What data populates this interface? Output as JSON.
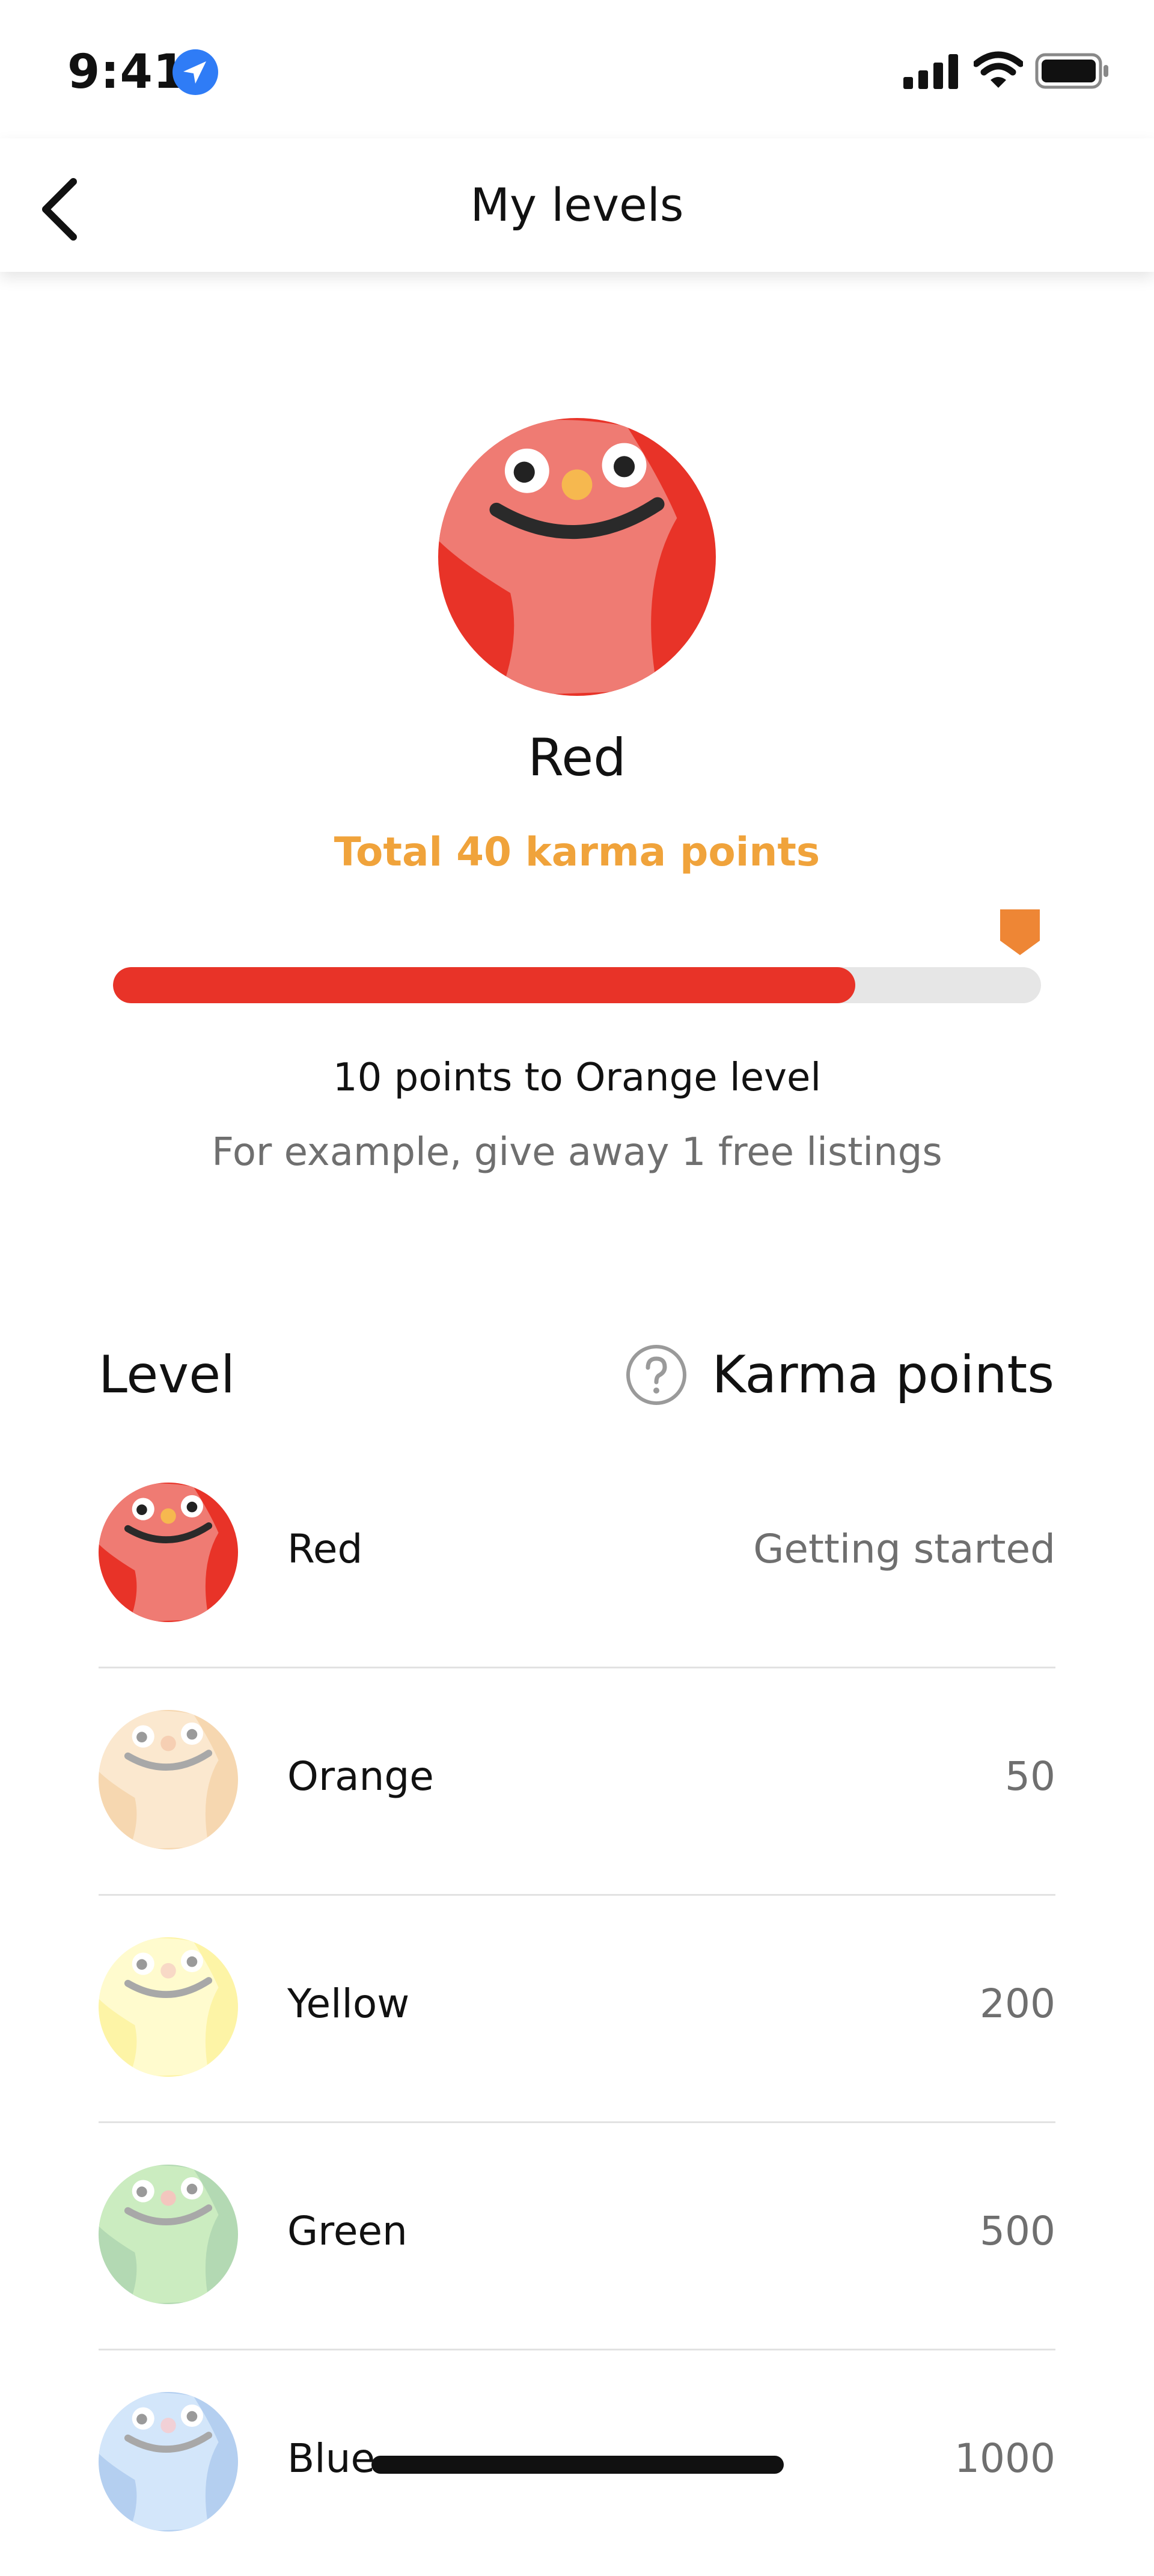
{
  "status_bar": {
    "time": "9:41",
    "icons": [
      "location-arrow-icon",
      "cellular-signal-icon",
      "wifi-icon",
      "battery-icon"
    ]
  },
  "nav": {
    "title": "My levels",
    "back_icon": "chevron-left-icon"
  },
  "current_level": {
    "name": "Red",
    "total_label": "Total 40 karma points",
    "progress_fraction": 0.8,
    "next_level_label": "10 points to Orange level",
    "hint": "For example, give away 1 free listings"
  },
  "table": {
    "level_header": "Level",
    "karma_header": "Karma points",
    "help_icon": "question-circle-icon"
  },
  "levels": [
    {
      "name": "Red",
      "points": "Getting started",
      "body": "#EF7B73",
      "rim": "#E83328",
      "current": true
    },
    {
      "name": "Orange",
      "points": "50",
      "body": "#FBE8CF",
      "rim": "#F6D7B0",
      "current": false
    },
    {
      "name": "Yellow",
      "points": "200",
      "body": "#FFFBCE",
      "rim": "#FDF4A6",
      "current": false
    },
    {
      "name": "Green",
      "points": "500",
      "body": "#CBECC0",
      "rim": "#B3D9B3",
      "current": false
    },
    {
      "name": "Blue",
      "points": "1000",
      "body": "#D3E6FA",
      "rim": "#B4CFF0",
      "current": false
    }
  ],
  "colors": {
    "accent_orange": "#F0A33B",
    "progress_red": "#E83328",
    "marker_orange": "#EE8635",
    "location_blue": "#2F7CF6"
  }
}
